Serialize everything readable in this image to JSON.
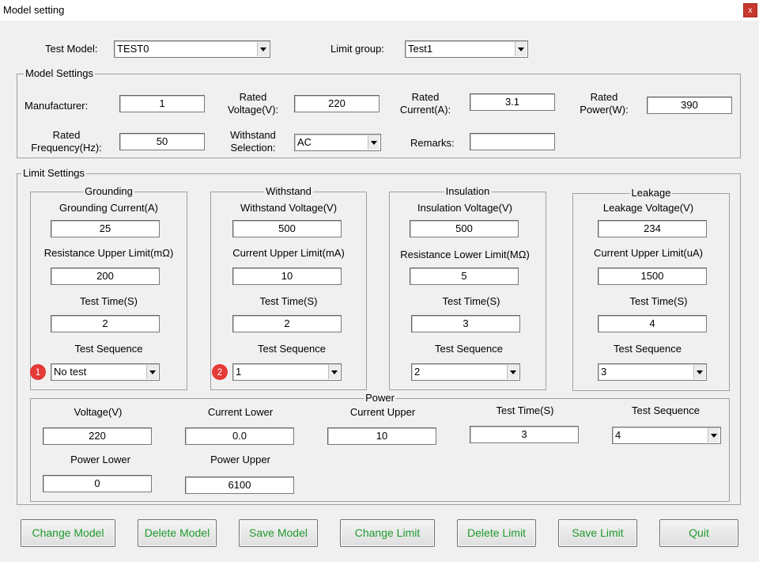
{
  "window": {
    "title": "Model setting",
    "close_label": "x"
  },
  "top": {
    "test_model_label": "Test Model:",
    "test_model_value": "TEST0",
    "limit_group_label": "Limit group:",
    "limit_group_value": "Test1"
  },
  "model_settings": {
    "title": "Model Settings",
    "manufacturer_label": "Manufacturer:",
    "manufacturer_value": "1",
    "rated_voltage_label_1": "Rated",
    "rated_voltage_label_2": "Voltage(V):",
    "rated_voltage_value": "220",
    "rated_current_label_1": "Rated",
    "rated_current_label_2": "Current(A):",
    "rated_current_value": "3.1",
    "rated_power_label_1": "Rated",
    "rated_power_label_2": "Power(W):",
    "rated_power_value": "390",
    "rated_frequency_label_1": "Rated",
    "rated_frequency_label_2": "Frequency(Hz):",
    "rated_frequency_value": "50",
    "withstand_selection_label_1": "Withstand",
    "withstand_selection_label_2": "Selection:",
    "withstand_selection_value": "AC",
    "remarks_label": "Remarks:",
    "remarks_value": ""
  },
  "limit_settings": {
    "title": "Limit Settings",
    "grounding": {
      "title": "Grounding",
      "current_label": "Grounding Current(A)",
      "current_value": "25",
      "resistance_label": "Resistance Upper Limit(mΩ)",
      "resistance_value": "200",
      "time_label": "Test Time(S)",
      "time_value": "2",
      "sequence_label": "Test Sequence",
      "sequence_value": "No test",
      "badge": "1"
    },
    "withstand": {
      "title": "Withstand",
      "voltage_label": "Withstand Voltage(V)",
      "voltage_value": "500",
      "current_label": "Current Upper Limit(mA)",
      "current_value": "10",
      "time_label": "Test Time(S)",
      "time_value": "2",
      "sequence_label": "Test Sequence",
      "sequence_value": "1",
      "badge": "2"
    },
    "insulation": {
      "title": "Insulation",
      "voltage_label": "Insulation Voltage(V)",
      "voltage_value": "500",
      "resistance_label": "Resistance Lower Limit(MΩ)",
      "resistance_value": "5",
      "time_label": "Test Time(S)",
      "time_value": "3",
      "sequence_label": "Test Sequence",
      "sequence_value": "2"
    },
    "leakage": {
      "title": "Leakage",
      "voltage_label": "Leakage Voltage(V)",
      "voltage_value": "234",
      "current_label": "Current Upper Limit(uA)",
      "current_value": "1500",
      "time_label": "Test Time(S)",
      "time_value": "4",
      "sequence_label": "Test Sequence",
      "sequence_value": "3"
    },
    "power": {
      "title": "Power",
      "voltage_label": "Voltage(V)",
      "voltage_value": "220",
      "current_lower_label": "Current Lower",
      "current_lower_value": "0.0",
      "current_upper_label": "Current Upper",
      "current_upper_value": "10",
      "time_label": "Test Time(S)",
      "time_value": "3",
      "sequence_label": "Test Sequence",
      "sequence_value": "4",
      "power_lower_label": "Power Lower",
      "power_lower_value": "0",
      "power_upper_label": "Power Upper",
      "power_upper_value": "6100"
    }
  },
  "buttons": {
    "change_model": "Change Model",
    "delete_model": "Delete Model",
    "save_model": "Save Model",
    "change_limit": "Change Limit",
    "delete_limit": "Delete Limit",
    "save_limit": "Save Limit",
    "quit": "Quit"
  },
  "colors": {
    "button_text": "#1f9a2e",
    "badge": "#e53935",
    "close_button": "#c7382f"
  }
}
